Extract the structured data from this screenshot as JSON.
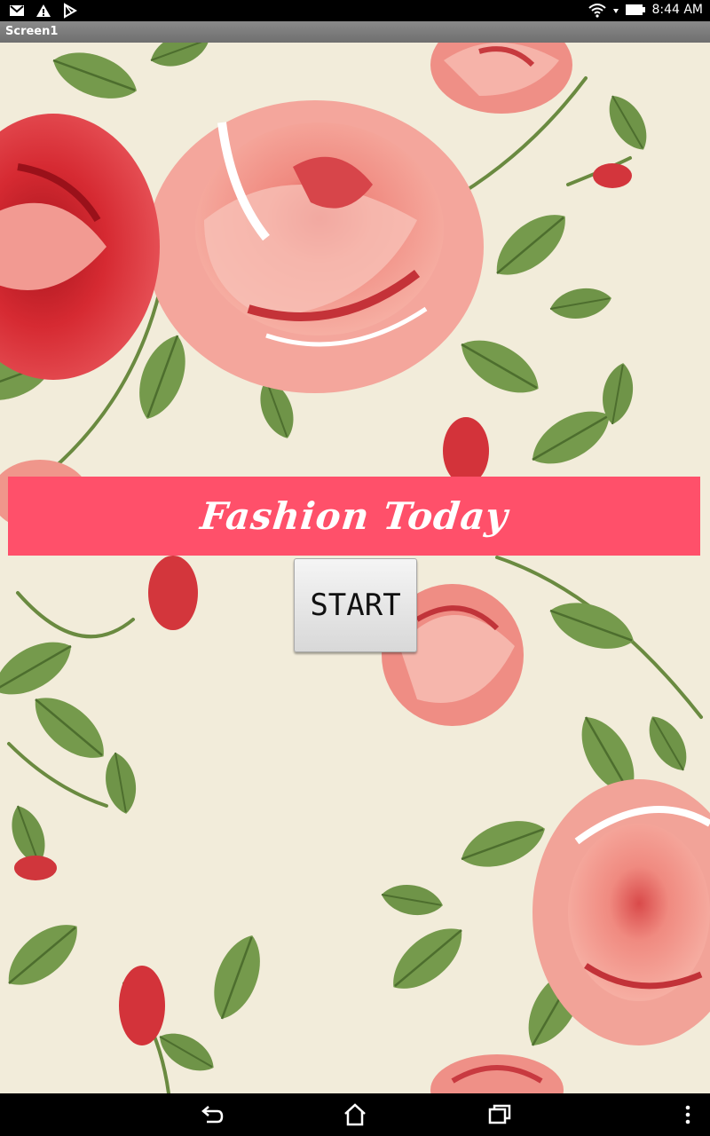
{
  "status_bar": {
    "time": "8:44 AM",
    "icons": [
      "gmail-icon",
      "warning-icon",
      "play-store-icon",
      "wifi-icon",
      "battery-icon"
    ]
  },
  "title_bar": {
    "title": "Screen1"
  },
  "main": {
    "banner_text": "Fashion Today",
    "start_label": "START",
    "colors": {
      "banner": "#ff506a",
      "background": "#f2ecda"
    }
  },
  "nav_bar": {
    "buttons": [
      "back-icon",
      "home-icon",
      "recents-icon",
      "menu-icon"
    ]
  }
}
